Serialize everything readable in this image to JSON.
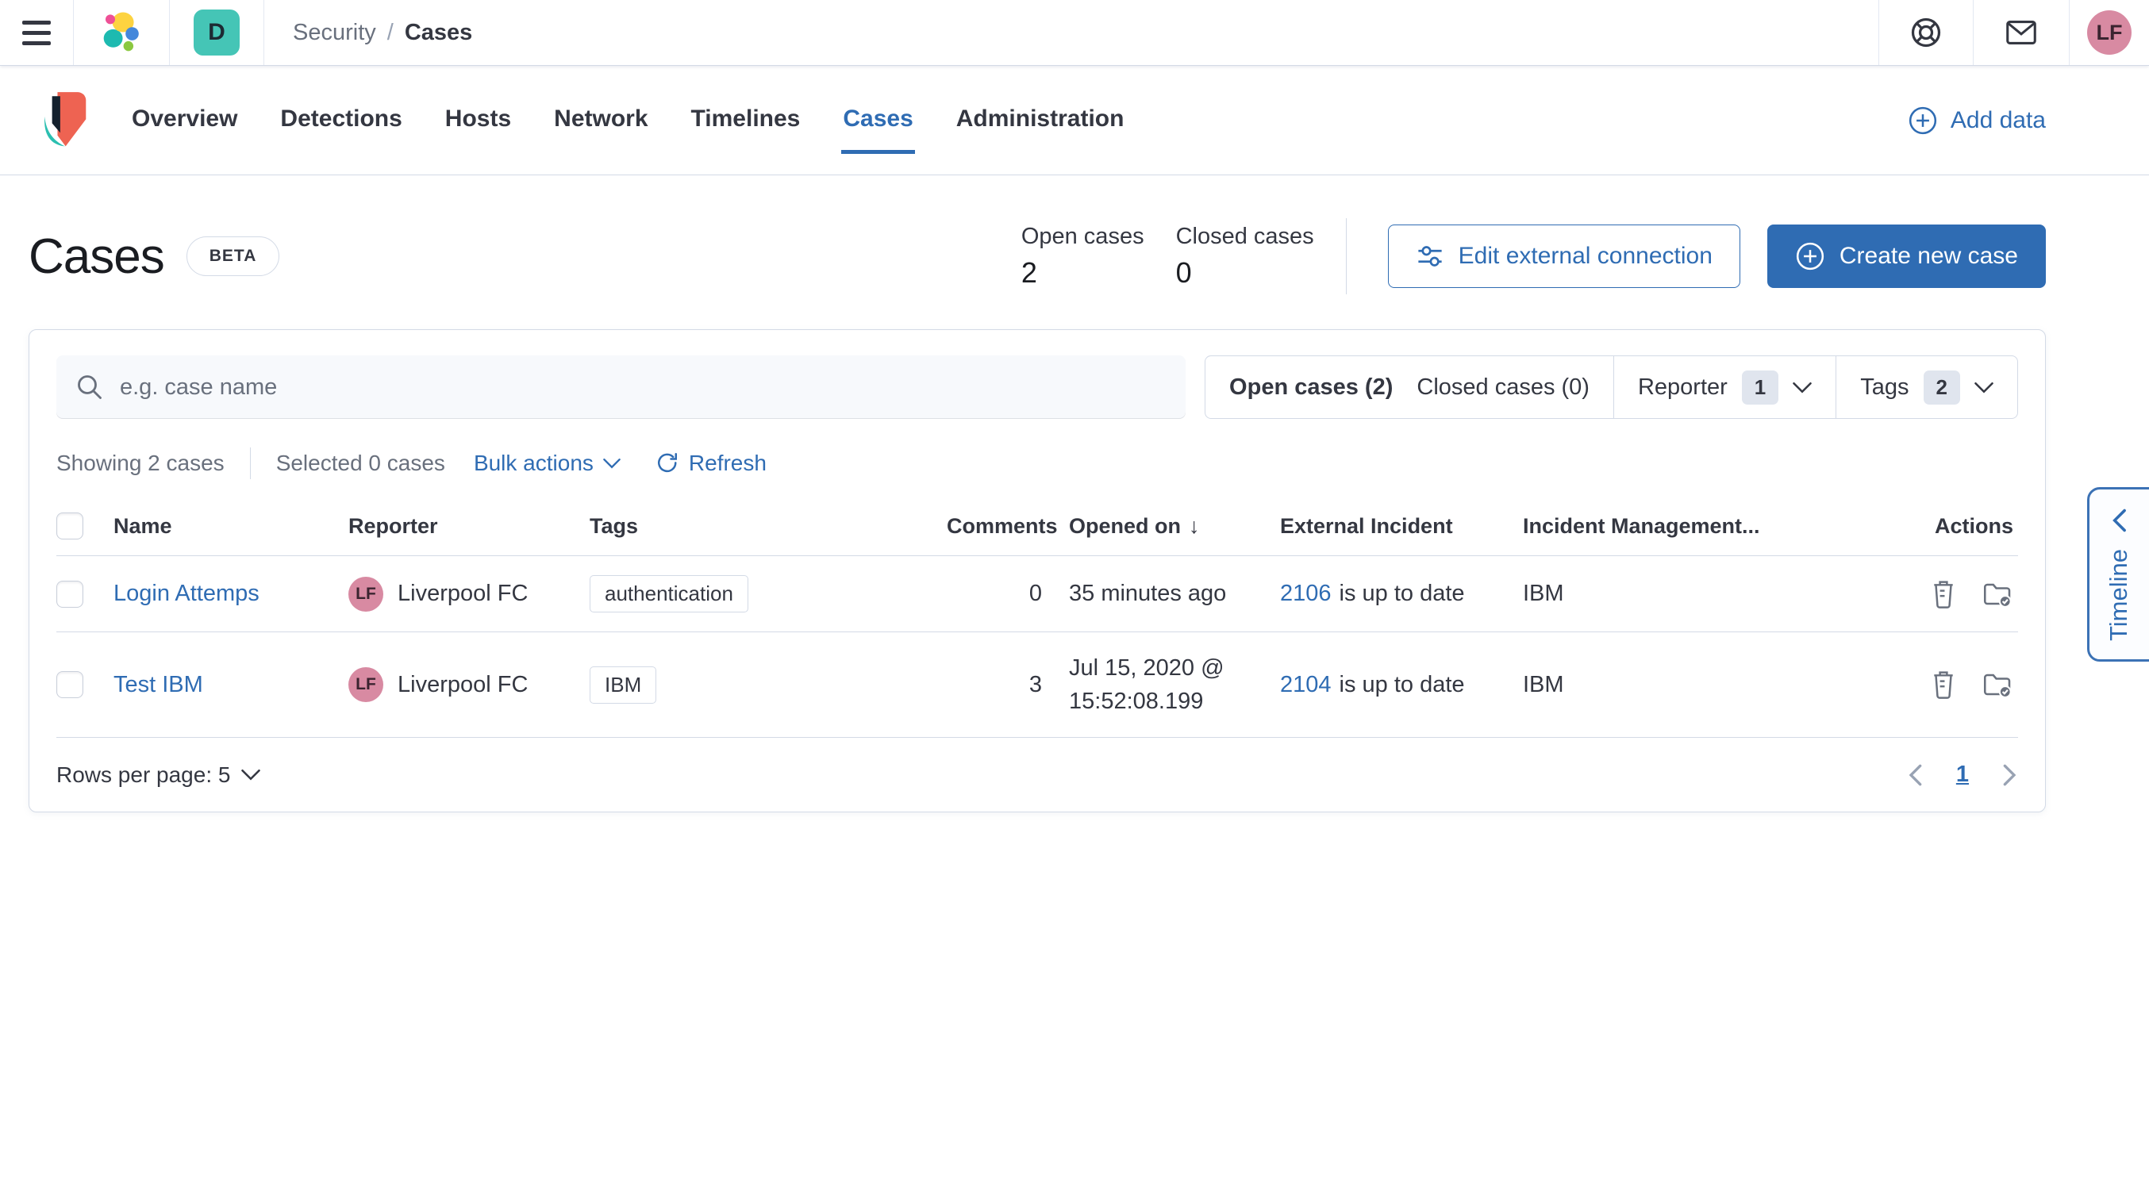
{
  "colors": {
    "primary": "#2F6CB3",
    "teal": "#45C5B6",
    "pink": "#D88AA2",
    "badge_bg": "#E0E5EE"
  },
  "header": {
    "space_badge": "D",
    "breadcrumb": {
      "section": "Security",
      "separator": "/",
      "current": "Cases"
    },
    "avatar_initials": "LF"
  },
  "nav": {
    "tabs": [
      {
        "label": "Overview"
      },
      {
        "label": "Detections"
      },
      {
        "label": "Hosts"
      },
      {
        "label": "Network"
      },
      {
        "label": "Timelines"
      },
      {
        "label": "Cases",
        "active": true
      },
      {
        "label": "Administration"
      }
    ],
    "add_data_label": "Add data"
  },
  "page": {
    "title": "Cases",
    "beta_label": "BETA",
    "stats": [
      {
        "label": "Open cases",
        "value": "2"
      },
      {
        "label": "Closed cases",
        "value": "0"
      }
    ],
    "edit_connection_label": "Edit external connection",
    "create_case_label": "Create new case"
  },
  "panel": {
    "search_placeholder": "e.g. case name",
    "filters": {
      "open_label": "Open cases (2)",
      "closed_label": "Closed cases (0)",
      "reporter_label": "Reporter",
      "reporter_count": "1",
      "tags_label": "Tags",
      "tags_count": "2"
    },
    "utility": {
      "showing": "Showing 2 cases",
      "selected": "Selected 0 cases",
      "bulk_actions": "Bulk actions",
      "refresh": "Refresh"
    },
    "table": {
      "columns": [
        "Name",
        "Reporter",
        "Tags",
        "Comments",
        "Opened on",
        "External Incident",
        "Incident Management...",
        "Actions"
      ],
      "rows": [
        {
          "name": "Login Attemps",
          "reporter": "Liverpool FC",
          "reporter_initials": "LF",
          "tags": [
            "authentication"
          ],
          "comments": "0",
          "opened_on": "35 minutes ago",
          "external_incident_link": "2106",
          "external_incident_status": "is up to date",
          "incident_management": "IBM"
        },
        {
          "name": "Test IBM",
          "reporter": "Liverpool FC",
          "reporter_initials": "LF",
          "tags": [
            "IBM"
          ],
          "comments": "3",
          "opened_on": "Jul 15, 2020 @ 15:52:08.199",
          "external_incident_link": "2104",
          "external_incident_status": "is up to date",
          "incident_management": "IBM"
        }
      ]
    },
    "footer": {
      "rows_per_page": "Rows per page: 5",
      "page": "1"
    }
  },
  "timeline_flyout": {
    "label": "Timeline"
  }
}
